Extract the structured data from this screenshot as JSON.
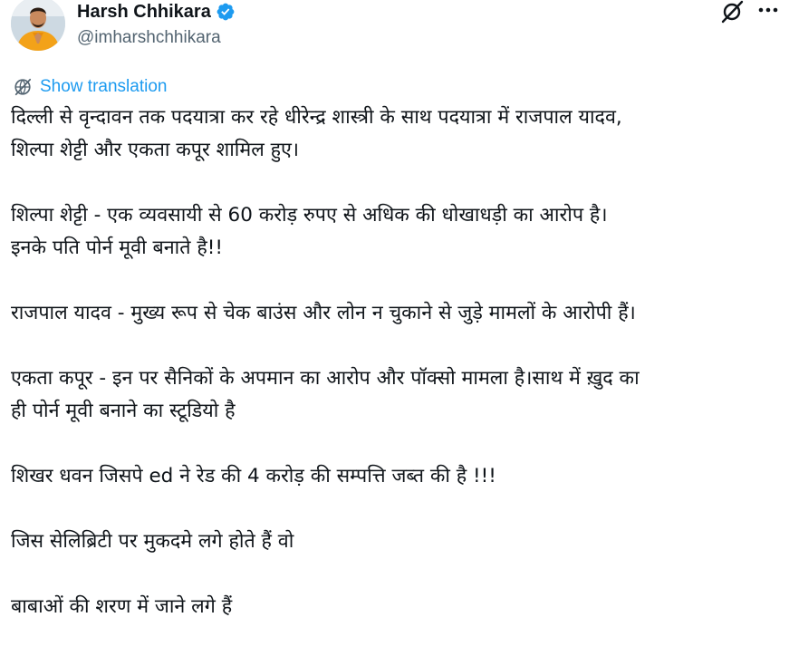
{
  "author": {
    "name": "Harsh Chhikara",
    "handle": "@imharshchhikara",
    "verified": true,
    "verified_color": "#1d9bf0"
  },
  "actions": {
    "grok_icon": "grok-icon",
    "more_icon": "more-icon"
  },
  "translation": {
    "label": "Show translation",
    "icon": "translate-globe-icon",
    "color": "#1d9bf0"
  },
  "tweet": {
    "paragraphs": [
      {
        "lines": [
          "दिल्ली से वृन्दावन तक पदयात्रा कर रहे धीरेन्द्र शास्त्री के साथ पदयात्रा में राजपाल यादव,",
          "शिल्पा शेट्टी और एकता कपूर शामिल हुए।"
        ]
      },
      {
        "lines": [
          "शिल्पा शेट्टी - एक व्यवसायी से 60 करोड़ रुपए से अधिक की धोखाधड़ी का आरोप है।",
          "इनके पति पोर्न मूवी बनाते है!!"
        ]
      },
      {
        "lines": [
          "राजपाल यादव - मुख्य रूप से चेक बाउंस और लोन न चुकाने से जुड़े मामलों के आरोपी हैं।"
        ]
      },
      {
        "lines": [
          "एकता कपूर - इन पर सैनिकों के अपमान का आरोप और पॉक्सो मामला है।साथ में ख़ुद का",
          "ही पोर्न मूवी बनाने का स्टूडियो है"
        ]
      },
      {
        "lines": [
          "शिखर धवन जिसपे ed ने रेड की 4 करोड़ की सम्पत्ति जब्त की है !!!"
        ]
      },
      {
        "lines": [
          "जिस सेलिब्रिटी पर मुकदमे लगे होते हैं वो"
        ]
      },
      {
        "lines": [
          "बाबाओं की शरण में जाने लगे हैं"
        ]
      }
    ]
  }
}
